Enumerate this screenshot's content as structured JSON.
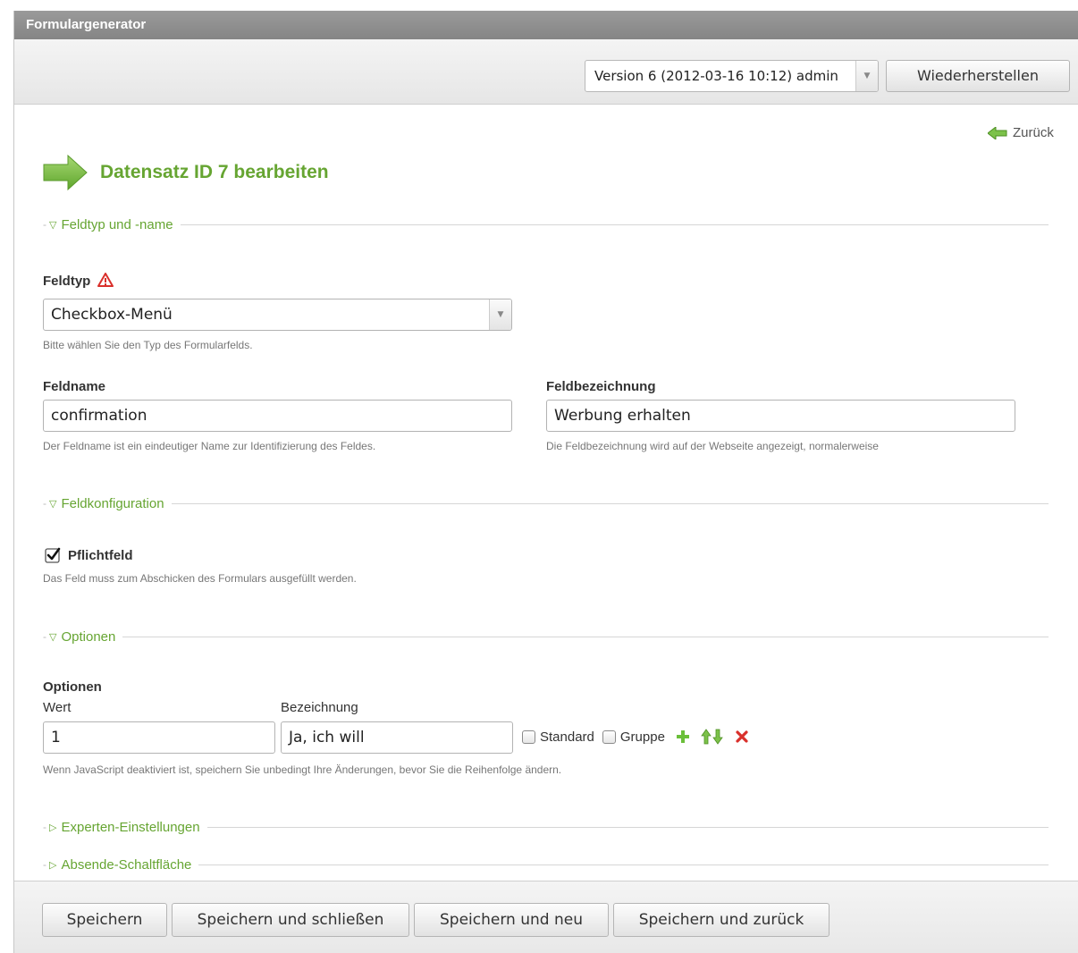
{
  "window": {
    "title": "Formulargenerator"
  },
  "toolbar": {
    "version_selected": "Version 6 (2012-03-16 10:12) admin",
    "restore_label": "Wiederherstellen"
  },
  "back_label": "Zurück",
  "page_title": "Datensatz ID 7 bearbeiten",
  "sections": {
    "type_name": "Feldtyp und -name",
    "config": "Feldkonfiguration",
    "options": "Optionen",
    "expert": "Experten-Einstellungen",
    "submit": "Absende-Schaltfläche"
  },
  "fieldtype": {
    "label": "Feldtyp",
    "value": "Checkbox-Menü",
    "help": "Bitte wählen Sie den Typ des Formularfelds."
  },
  "fieldname": {
    "label": "Feldname",
    "value": "confirmation",
    "help": "Der Feldname ist ein eindeutiger Name zur Identifizierung des Feldes."
  },
  "fieldlabel": {
    "label": "Feldbezeichnung",
    "value": "Werbung erhalten",
    "help": "Die Feldbezeichnung wird auf der Webseite angezeigt, normalerweise"
  },
  "required": {
    "label": "Pflichtfeld",
    "checked": true,
    "help": "Das Feld muss zum Abschicken des Formulars ausgefüllt werden."
  },
  "options": {
    "heading": "Optionen",
    "col_value": "Wert",
    "col_label": "Bezeichnung",
    "rows": [
      {
        "value": "1",
        "label": "Ja, ich will",
        "standard_label": "Standard",
        "group_label": "Gruppe"
      }
    ],
    "help": "Wenn JavaScript deaktiviert ist, speichern Sie unbedingt Ihre Änderungen, bevor Sie die Reihenfolge ändern."
  },
  "footer": {
    "save": "Speichern",
    "save_close": "Speichern und schließen",
    "save_new": "Speichern und neu",
    "save_back": "Speichern und zurück"
  },
  "colors": {
    "accent": "#66a532",
    "titlebar": "#8e8e8e",
    "danger": "#d9302b"
  }
}
